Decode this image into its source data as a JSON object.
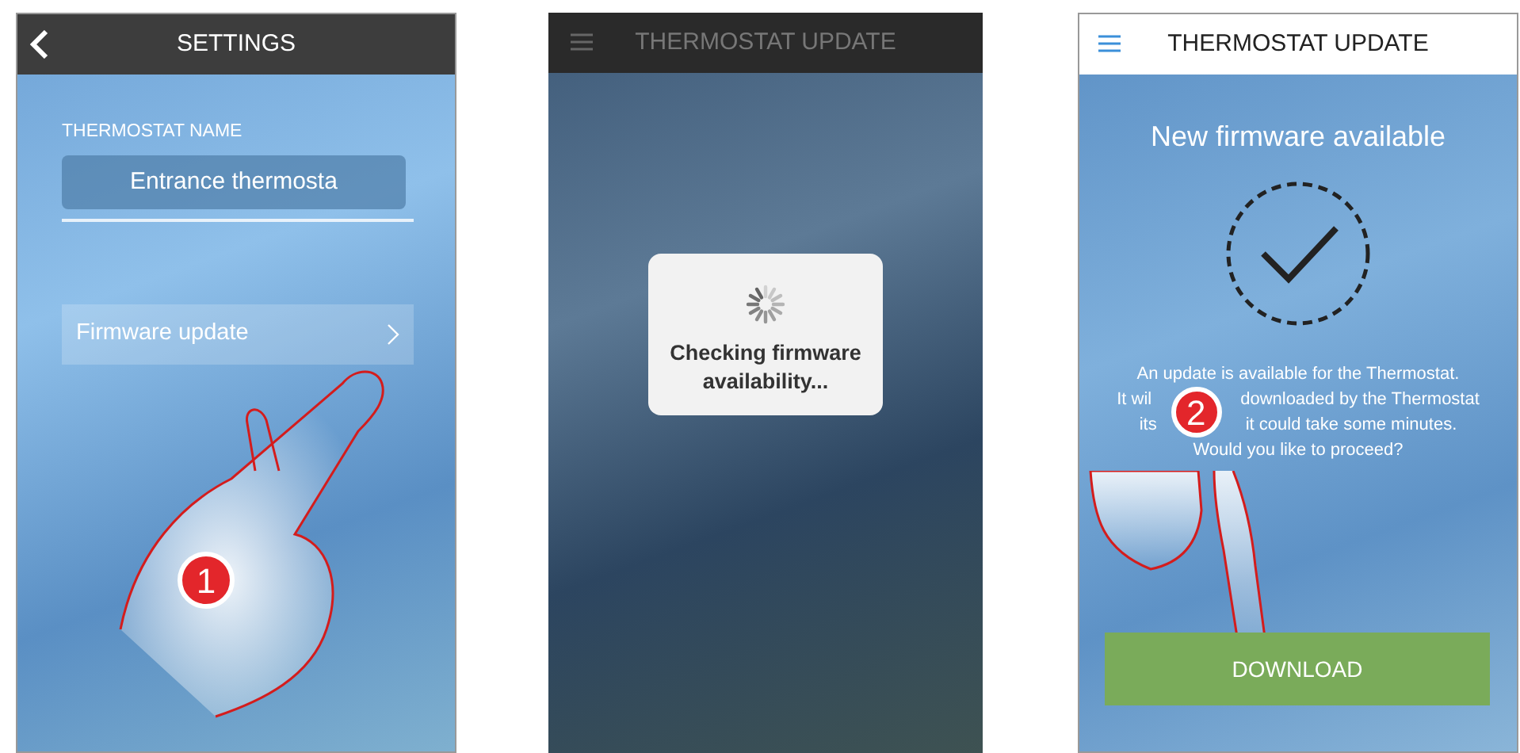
{
  "screens": [
    {
      "kind": "settings",
      "header": {
        "title": "SETTINGS"
      },
      "field_label": "THERMOSTAT NAME",
      "field_value": "Entrance thermosta",
      "menu_item": "Firmware update",
      "step": "1"
    },
    {
      "kind": "checking",
      "header": {
        "title": "THERMOSTAT UPDATE"
      },
      "dialog_text": "Checking firmware availability..."
    },
    {
      "kind": "available",
      "header": {
        "title": "THERMOSTAT UPDATE"
      },
      "heading": "New firmware available",
      "message_lines": [
        [
          "An update is available for the Thermostat."
        ],
        [
          "It wil",
          "downloaded by the Thermostat"
        ],
        [
          "its",
          "it could take some minutes."
        ],
        [
          "Would you like to proceed?"
        ]
      ],
      "button": "DOWNLOAD",
      "step": "2"
    }
  ]
}
